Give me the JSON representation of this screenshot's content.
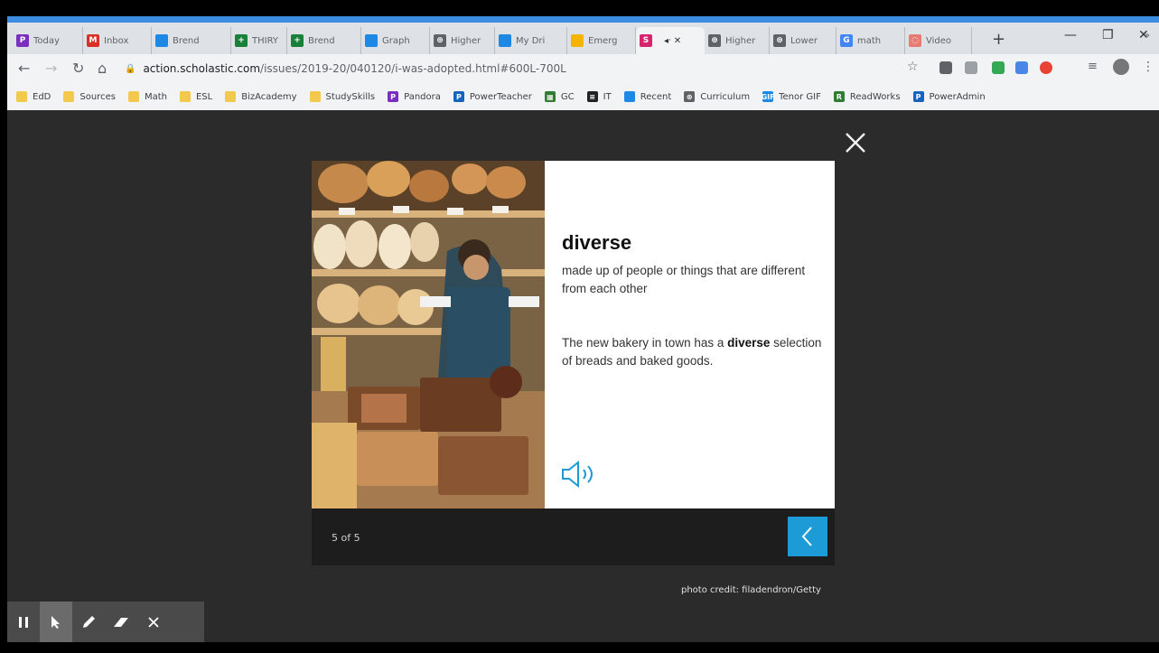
{
  "browser": {
    "tabs": [
      {
        "label": "Today",
        "icon": "pandora-icon",
        "color": "#7b2fbe",
        "glyph": "P"
      },
      {
        "label": "Inbox",
        "icon": "gmail-icon",
        "color": "#d93025",
        "glyph": "M"
      },
      {
        "label": "Brend",
        "icon": "drive-icon",
        "color": "#1e88e5",
        "glyph": ""
      },
      {
        "label": "THIRY",
        "icon": "sheets-plus-icon",
        "color": "#188038",
        "glyph": "+"
      },
      {
        "label": "Brend",
        "icon": "sheets-plus-icon",
        "color": "#188038",
        "glyph": "+"
      },
      {
        "label": "Graph",
        "icon": "drive-icon",
        "color": "#1e88e5",
        "glyph": ""
      },
      {
        "label": "Higher",
        "icon": "globe-icon",
        "color": "#5f6368",
        "glyph": "⊛"
      },
      {
        "label": "My Dri",
        "icon": "drive-icon",
        "color": "#1e88e5",
        "glyph": ""
      },
      {
        "label": "Emerg",
        "icon": "slides-icon",
        "color": "#f4b400",
        "glyph": ""
      },
      {
        "label": "",
        "icon": "scholastic-icon",
        "color": "#d6246e",
        "glyph": "S",
        "active": true
      },
      {
        "label": "Higher",
        "icon": "globe-icon",
        "color": "#5f6368",
        "glyph": "⊛"
      },
      {
        "label": "Lower",
        "icon": "globe-icon",
        "color": "#5f6368",
        "glyph": "⊛"
      },
      {
        "label": "math",
        "icon": "google-icon",
        "color": "#4285f4",
        "glyph": "G"
      },
      {
        "label": "Video",
        "icon": "video-icon",
        "color": "#e67c73",
        "glyph": "◌"
      }
    ],
    "url_host": "action.scholastic.com",
    "url_path": "/issues/2019-20/040120/i-was-adopted.html#600L-700L",
    "bookmarks": [
      {
        "label": "EdD",
        "type": "folder"
      },
      {
        "label": "Sources",
        "type": "folder"
      },
      {
        "label": "Math",
        "type": "folder"
      },
      {
        "label": "ESL",
        "type": "folder"
      },
      {
        "label": "BizAcademy",
        "type": "folder"
      },
      {
        "label": "StudySkills",
        "type": "folder"
      },
      {
        "label": "Pandora",
        "type": "site",
        "color": "#7b2fbe",
        "glyph": "P"
      },
      {
        "label": "PowerTeacher",
        "type": "site",
        "color": "#1565c0",
        "glyph": "P"
      },
      {
        "label": "GC",
        "type": "site",
        "color": "#2e7d32",
        "glyph": "▦"
      },
      {
        "label": "IT",
        "type": "site",
        "color": "#222222",
        "glyph": "≡"
      },
      {
        "label": "Recent",
        "type": "site",
        "color": "#1e88e5",
        "glyph": ""
      },
      {
        "label": "Curriculum",
        "type": "site",
        "color": "#5f6368",
        "glyph": "⊛"
      },
      {
        "label": "Tenor GIF",
        "type": "site",
        "color": "#1e88e5",
        "glyph": "GIF"
      },
      {
        "label": "ReadWorks",
        "type": "site",
        "color": "#2e7d32",
        "glyph": "R"
      },
      {
        "label": "PowerAdmin",
        "type": "site",
        "color": "#1565c0",
        "glyph": "P"
      }
    ],
    "more_bookmarks": "»"
  },
  "vocab": {
    "word": "diverse",
    "definition": "made up of people or things that are different from each other",
    "example_before": "The new bakery in town has a ",
    "example_bold": "diverse",
    "example_after": " selection of breads and baked goods.",
    "counter": "5 of 5",
    "credit": "photo credit: filadendron/Getty",
    "accent": "#1d9bd7"
  }
}
